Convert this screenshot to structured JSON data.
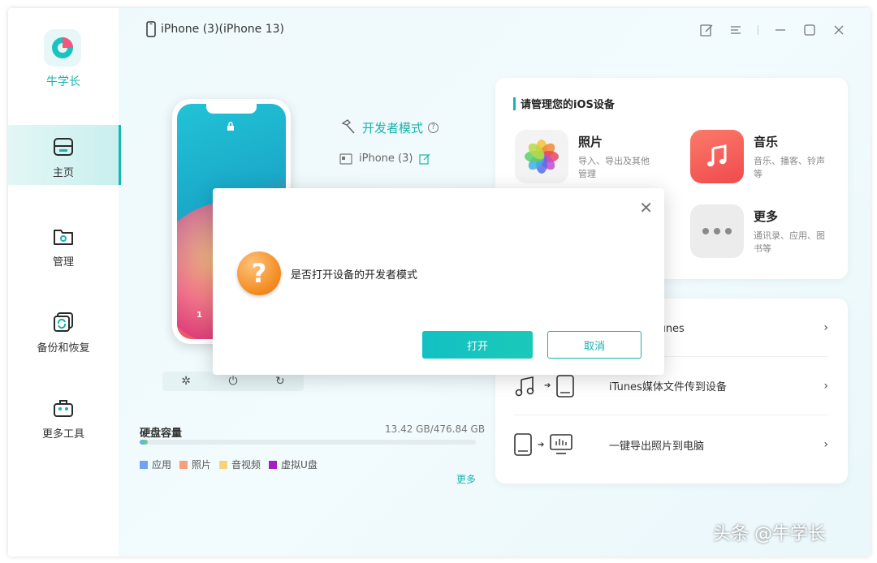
{
  "app": {
    "name": "牛学长",
    "device_title": "iPhone (3)(iPhone 13)"
  },
  "sidebar": {
    "items": [
      {
        "label": "主页",
        "icon": "home-icon",
        "active": true
      },
      {
        "label": "管理",
        "icon": "folder-gear-icon",
        "active": false
      },
      {
        "label": "备份和恢复",
        "icon": "backup-restore-icon",
        "active": false
      },
      {
        "label": "更多工具",
        "icon": "toolbox-icon",
        "active": false
      }
    ]
  },
  "device": {
    "developer_mode_label": "开发者模式",
    "name": "iPhone (3)",
    "screen_number": "1"
  },
  "disk": {
    "title": "硬盘容量",
    "usage": "13.42 GB/476.84 GB",
    "legend": [
      {
        "label": "应用",
        "color": "#6fa3f5"
      },
      {
        "label": "照片",
        "color": "#f5a07a"
      },
      {
        "label": "音视频",
        "color": "#f7d27c"
      },
      {
        "label": "虚拟U盘",
        "color": "#a020c0"
      }
    ],
    "more_label": "更多"
  },
  "manage": {
    "title": "请管理您的iOS设备",
    "features": [
      {
        "title": "照片",
        "desc": "导入、导出及其他管理",
        "icon": "photos-icon"
      },
      {
        "title": "音乐",
        "desc": "音乐、播客、铃声等",
        "icon": "music-icon"
      },
      {
        "title": "更多",
        "desc": "通讯录、应用、图书等",
        "icon": "more-dots-icon"
      }
    ]
  },
  "transfer": {
    "rows": [
      {
        "label": "文件传到iTunes",
        "icon": "device-to-itunes-icon"
      },
      {
        "label": "iTunes媒体文件传到设备",
        "icon": "itunes-to-device-icon"
      },
      {
        "label": "一键导出照片到电脑",
        "icon": "photos-to-pc-icon"
      }
    ]
  },
  "dialog": {
    "message": "是否打开设备的开发者模式",
    "confirm_label": "打开",
    "cancel_label": "取消"
  },
  "watermark": "头条 @牛学长",
  "colors": {
    "accent": "#19b3ad",
    "warning": "#f28a1e"
  }
}
